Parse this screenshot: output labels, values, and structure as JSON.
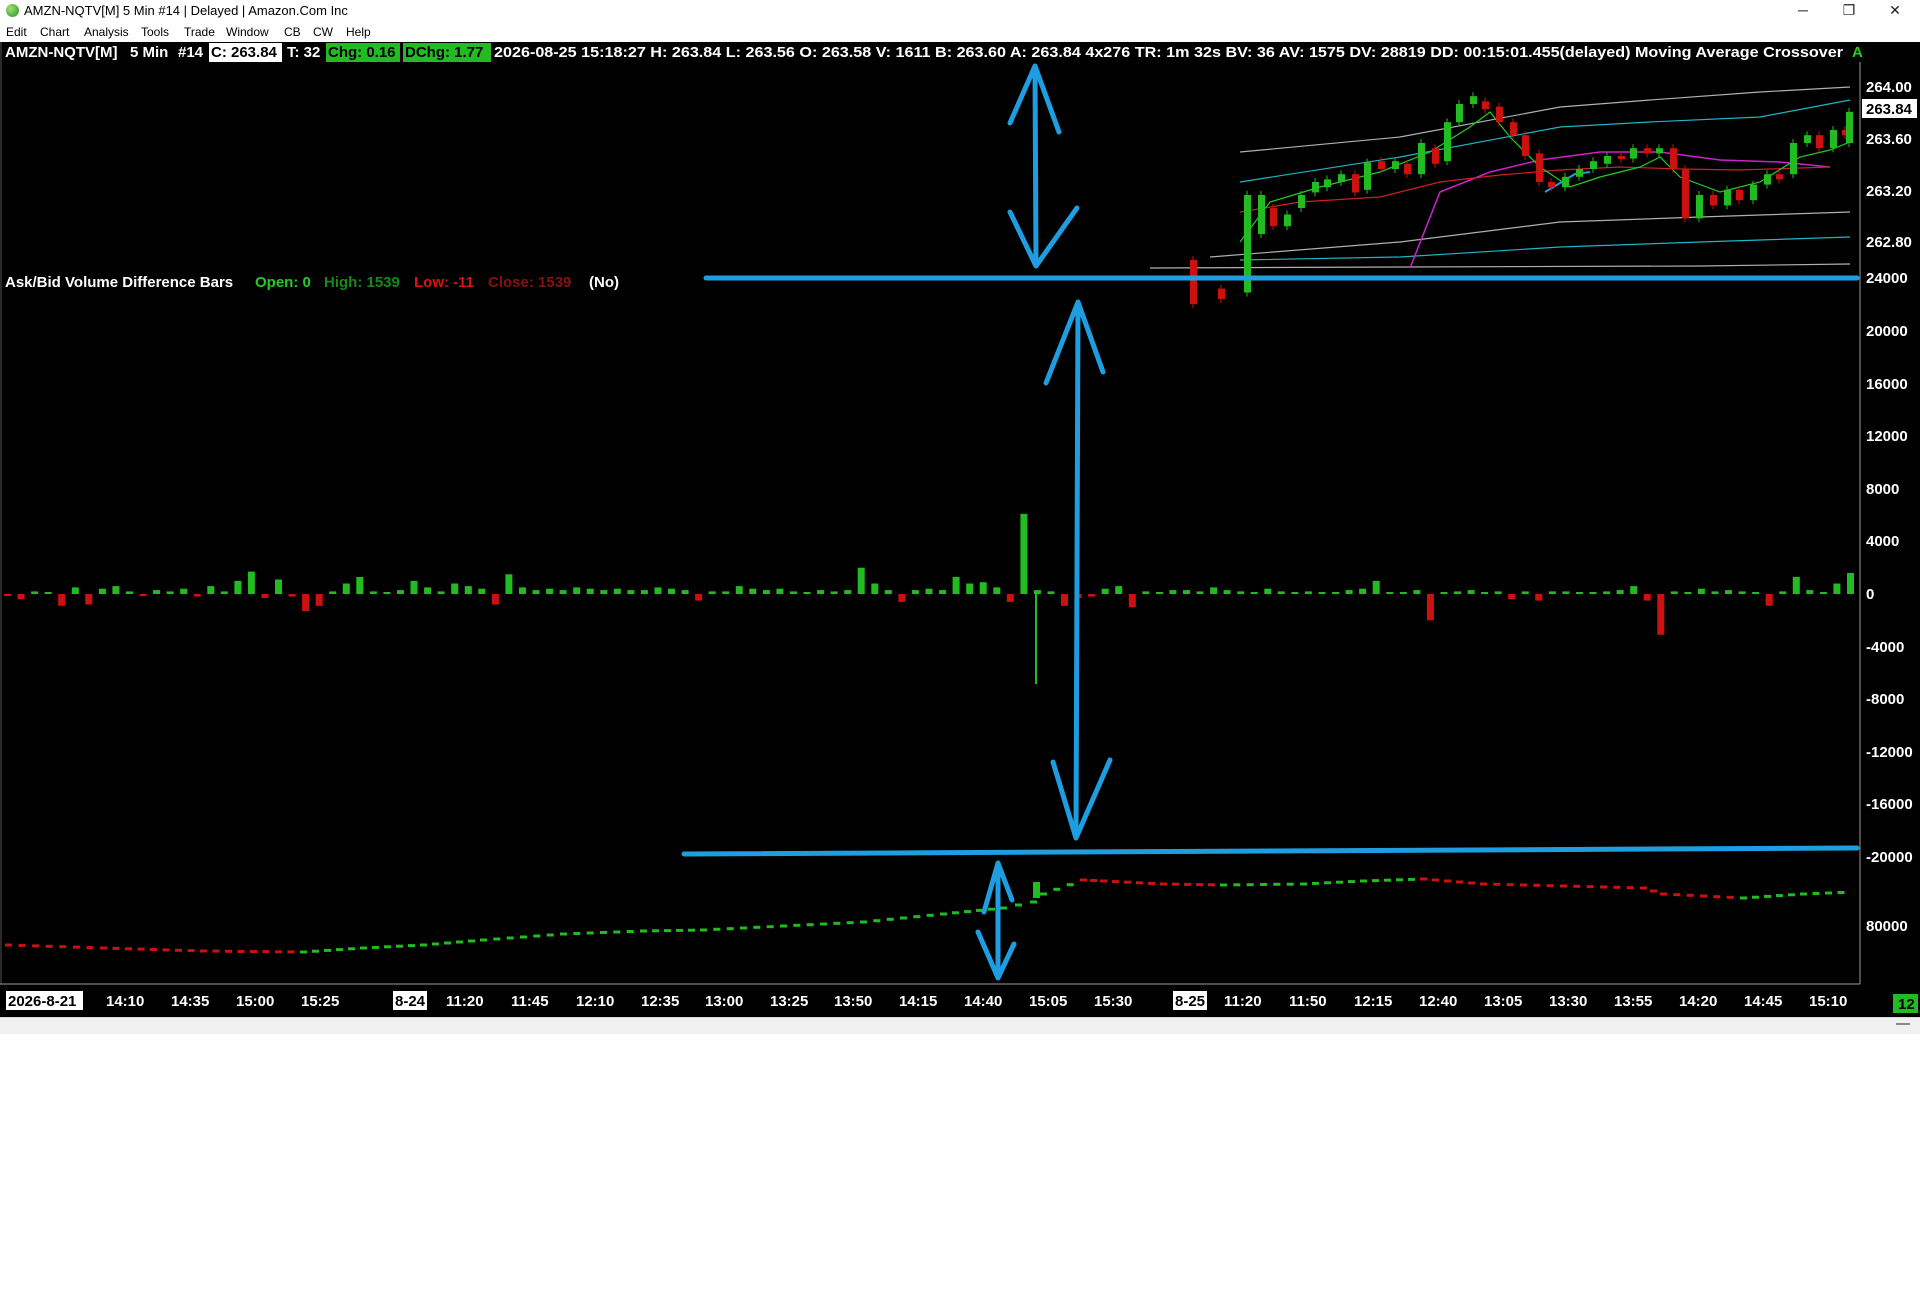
{
  "window": {
    "title": "AMZN-NQTV[M]  5 Min  #14 | Delayed | Amazon.Com Inc",
    "controls": {
      "minimize": "─",
      "restore": "❐",
      "close": "✕"
    }
  },
  "menu": [
    "Edit",
    "Chart",
    "Analysis",
    "Tools",
    "Trade",
    "Window",
    "CB",
    "CW",
    "Help"
  ],
  "header": {
    "symbol": "AMZN-NQTV[M]",
    "interval": "5 Min",
    "chart_no": "#14",
    "close": "C: 263.84",
    "ticks": "T: 32",
    "chg": "Chg: 0.16",
    "dchg": "DChg: 1.77",
    "rest": "2026-08-25 15:18:27 H: 263.84 L: 263.56 O: 263.58 V: 1611 B: 263.60 A: 263.84 4x276 TR: 1m 32s BV: 36 AV: 1575 DV: 28819 DD: 00:15:01.455(delayed) Moving Average Crossover",
    "study_tail": "A"
  },
  "study": {
    "name": "Ask/Bid Volume Difference Bars",
    "open": "Open: 0",
    "high": "High: 1539",
    "low": "Low: -11",
    "close": "Close: 1539",
    "flag": "(No)"
  },
  "price_scale": {
    "labels": [
      "264.00",
      "263.60",
      "263.20",
      "262.80"
    ],
    "current": "263.84"
  },
  "volume_scale": {
    "labels": [
      "24000",
      "20000",
      "16000",
      "12000",
      "8000",
      "4000",
      "0",
      "-4000",
      "-8000",
      "-12000",
      "-16000",
      "-20000"
    ]
  },
  "cumulative_scale": {
    "label": "80000"
  },
  "time_axis": {
    "labels": [
      "2026-8-21",
      "14:10",
      "14:35",
      "15:00",
      "15:25",
      "8-24",
      "11:20",
      "11:45",
      "12:10",
      "12:35",
      "13:00",
      "13:25",
      "13:50",
      "14:15",
      "14:40",
      "15:05",
      "15:30",
      "8-25",
      "11:20",
      "11:50",
      "12:15",
      "12:40",
      "13:05",
      "13:30",
      "13:55",
      "14:20",
      "14:45",
      "15:10"
    ],
    "corner_badge": "12"
  },
  "colors": {
    "background": "#000000",
    "up": "#22bb22",
    "down": "#cc1111",
    "annotation": "#1e9ee0",
    "ma_fast": "#22cc22",
    "ma_slow": "#cc22cc",
    "ma_mid": "#cc2222",
    "band_outer": "#1fb5c4",
    "band_inner": "#b0b0b0"
  },
  "volume_bars": [
    -150,
    -400,
    200,
    100,
    -900,
    500,
    -800,
    400,
    600,
    200,
    -100,
    300,
    200,
    400,
    -200,
    600,
    200,
    1000,
    1700,
    -300,
    1100,
    -200,
    -1300,
    -900,
    200,
    800,
    1300,
    200,
    100,
    300,
    1000,
    500,
    200,
    800,
    600,
    400,
    -800,
    1500,
    500,
    300,
    400,
    300,
    500,
    400,
    300,
    400,
    300,
    300,
    500,
    400,
    300,
    -500,
    200,
    200,
    600,
    400,
    300,
    400,
    200,
    100,
    300,
    200,
    300,
    2000,
    800,
    300,
    -600,
    300,
    400,
    300,
    1300,
    800,
    900,
    500,
    -600,
    6100,
    300,
    200,
    -900,
    -300,
    -200,
    400,
    600,
    -1000,
    200,
    100,
    300,
    300,
    200,
    500,
    300,
    200,
    100,
    400,
    200,
    100,
    200,
    100,
    100,
    300,
    400,
    1000,
    100,
    100,
    300,
    -2000,
    100,
    200,
    300,
    100,
    200,
    -400,
    200,
    -500,
    200,
    200,
    100,
    100,
    200,
    300,
    600,
    -500,
    -3100,
    200,
    100,
    400,
    200,
    300,
    200,
    100,
    -900,
    200,
    1300,
    300,
    100,
    800,
    1600
  ]
}
